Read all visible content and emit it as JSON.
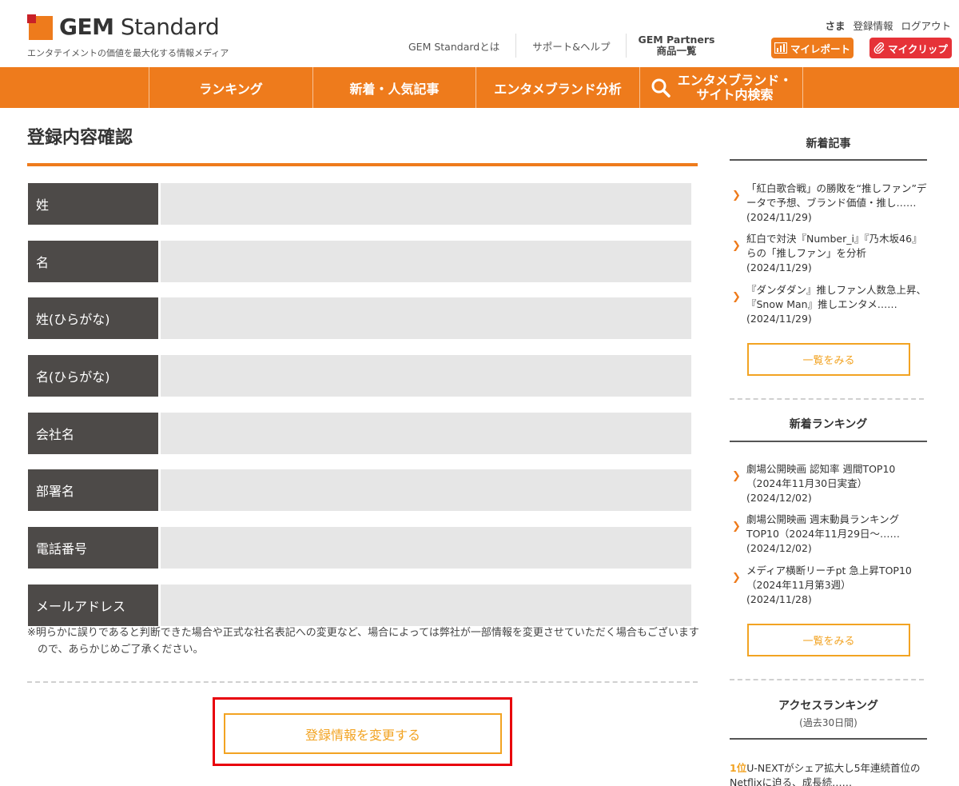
{
  "header": {
    "logo_bold": "GEM",
    "logo_rest": "Standard",
    "tagline": "エンタテイメントの価値を最大化する情報メディア",
    "nav": {
      "about": "GEM Standardとは",
      "support": "サポート&ヘルプ",
      "partners_line1": "GEM Partners",
      "partners_line2": "商品一覧"
    },
    "user": {
      "sama": "さま",
      "registration": "登録情報",
      "logout": "ログアウト"
    },
    "buttons": {
      "my_report": "マイレポート",
      "my_clip": "マイクリップ"
    }
  },
  "navbar": {
    "ranking": "ランキング",
    "new_articles": "新着・人気記事",
    "brand_analysis": "エンタメブランド分析",
    "search_line1": "エンタメブランド・",
    "search_line2": "サイト内検索"
  },
  "main": {
    "title": "登録内容確認",
    "fields": [
      {
        "label": "姓",
        "value": ""
      },
      {
        "label": "名",
        "value": ""
      },
      {
        "label": "姓(ひらがな)",
        "value": ""
      },
      {
        "label": "名(ひらがな)",
        "value": ""
      },
      {
        "label": "会社名",
        "value": ""
      },
      {
        "label": "部署名",
        "value": ""
      },
      {
        "label": "電話番号",
        "value": ""
      },
      {
        "label": "メールアドレス",
        "value": ""
      }
    ],
    "note": "※明らかに誤りであると判断できた場合や正式な社名表記への変更など、場合によっては弊社が一部情報を変更させていただく場合もございますので、あらかじめご了承ください。",
    "change_button": "登録情報を変更する"
  },
  "sidebar": {
    "new_articles": {
      "heading": "新着記事",
      "items": [
        {
          "title": "「紅白歌合戦」の勝敗を“推しファン”データで予想、ブランド価値・推し……",
          "date": "(2024/11/29)"
        },
        {
          "title": "紅白で対決『Number_i』『乃木坂46』らの「推しファン」を分析",
          "date": "(2024/11/29)"
        },
        {
          "title": "『ダンダダン』推しファン人数急上昇、『Snow Man』推しエンタメ……",
          "date": "(2024/11/29)"
        }
      ],
      "more": "一覧をみる"
    },
    "new_rankings": {
      "heading": "新着ランキング",
      "items": [
        {
          "title": "劇場公開映画 認知率 週間TOP10（2024年11月30日実査）",
          "date": "(2024/12/02)"
        },
        {
          "title": "劇場公開映画 週末動員ランキングTOP10（2024年11月29日〜……",
          "date": "(2024/12/02)"
        },
        {
          "title": "メディア横断リーチpt 急上昇TOP10（2024年11月第3週）",
          "date": "(2024/11/28)"
        }
      ],
      "more": "一覧をみる"
    },
    "access_ranking": {
      "heading": "アクセスランキング",
      "subheading": "(過去30日間)",
      "items": [
        {
          "rank": "1位",
          "title": "U-NEXTがシェア拡大し5年連続首位のNetflixに迫る、成長続……"
        }
      ]
    }
  },
  "colors": {
    "brand_orange": "#ee7b1c",
    "button_orange": "#f2a322",
    "clip_red": "#e63238",
    "label_dark": "#4d4a48",
    "value_gray": "#e6e6e6",
    "highlight_red": "#e8000b"
  }
}
